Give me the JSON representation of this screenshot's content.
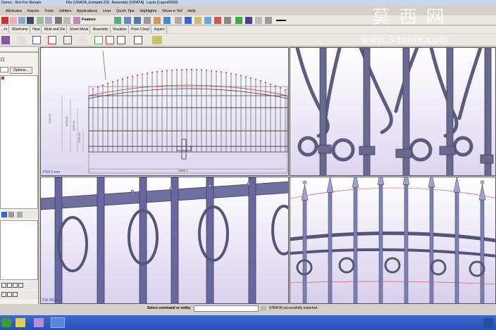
{
  "window": {
    "title": "Demo - Not For Resale",
    "file": "File [VRATA_komplet.Z3]",
    "assembly": "Assembly [VRATA]",
    "layer": "Layer [Layer0000]",
    "menu": "Help"
  },
  "menu": [
    "Attributes",
    "Inquire",
    "Tools",
    "Utilities",
    "Applications",
    "User",
    "Quick Tips",
    "Highlights",
    "Show-n-Tell",
    "Help"
  ],
  "toolbar": {
    "feature_label": "Feature"
  },
  "tabs": [
    "...m",
    "Wireframe",
    "Heal",
    "Mold and Die",
    "Sheet Metal",
    "Assembly",
    "Visualize",
    "Point Cloud",
    "Inquire"
  ],
  "left_panel": {
    "options_label": "Options..."
  },
  "viewports": [
    {
      "label": "2750.0 mm"
    },
    {
      "label": ""
    },
    {
      "label": "216.061 m"
    },
    {
      "label": ""
    }
  ],
  "drawing": {
    "width_dim": "5960.0",
    "heights": [
      "1640.00",
      "1530.00",
      "1280.00",
      "1030.00"
    ]
  },
  "status": {
    "prompt": "Select command or entity.",
    "message": "[VRATA] successfully exported."
  },
  "watermark": {
    "cn": "莫 西 网",
    "url": "www.3dmox.com"
  },
  "colors": {
    "viewport_top": "#ffffff",
    "viewport_bottom": "#d8d0ec",
    "iron": "#6a6a88"
  }
}
